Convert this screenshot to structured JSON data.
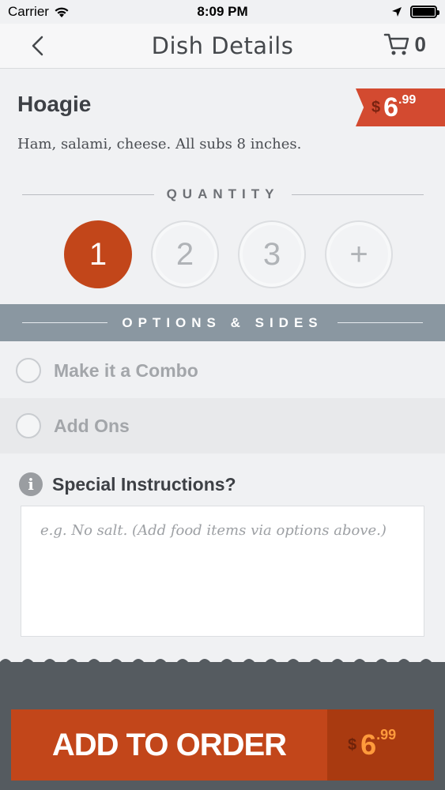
{
  "status_bar": {
    "carrier": "Carrier",
    "time": "8:09 PM"
  },
  "nav": {
    "title": "Dish Details",
    "cart_count": "0"
  },
  "dish": {
    "name": "Hoagie",
    "description": "Ham, salami, cheese. All subs 8 inches.",
    "price": {
      "dollar_sign": "$",
      "whole": "6",
      "cents": ".99"
    }
  },
  "quantity": {
    "label": "QUANTITY",
    "options": [
      "1",
      "2",
      "3",
      "+"
    ],
    "selected": "1"
  },
  "options": {
    "label": "OPTIONS & SIDES",
    "items": [
      {
        "label": "Make it a Combo"
      },
      {
        "label": "Add Ons"
      }
    ]
  },
  "instructions": {
    "label": "Special Instructions?",
    "placeholder": "e.g. No salt. (Add food items via options above.)"
  },
  "add_to_order": {
    "label": "ADD TO ORDER",
    "price": {
      "dollar_sign": "$",
      "whole": "6",
      "cents": ".99"
    }
  },
  "colors": {
    "accent": "#c2461a",
    "price_tag": "#d34a30",
    "options_bar": "#8a97a1",
    "bottom_bg": "#555b60"
  }
}
